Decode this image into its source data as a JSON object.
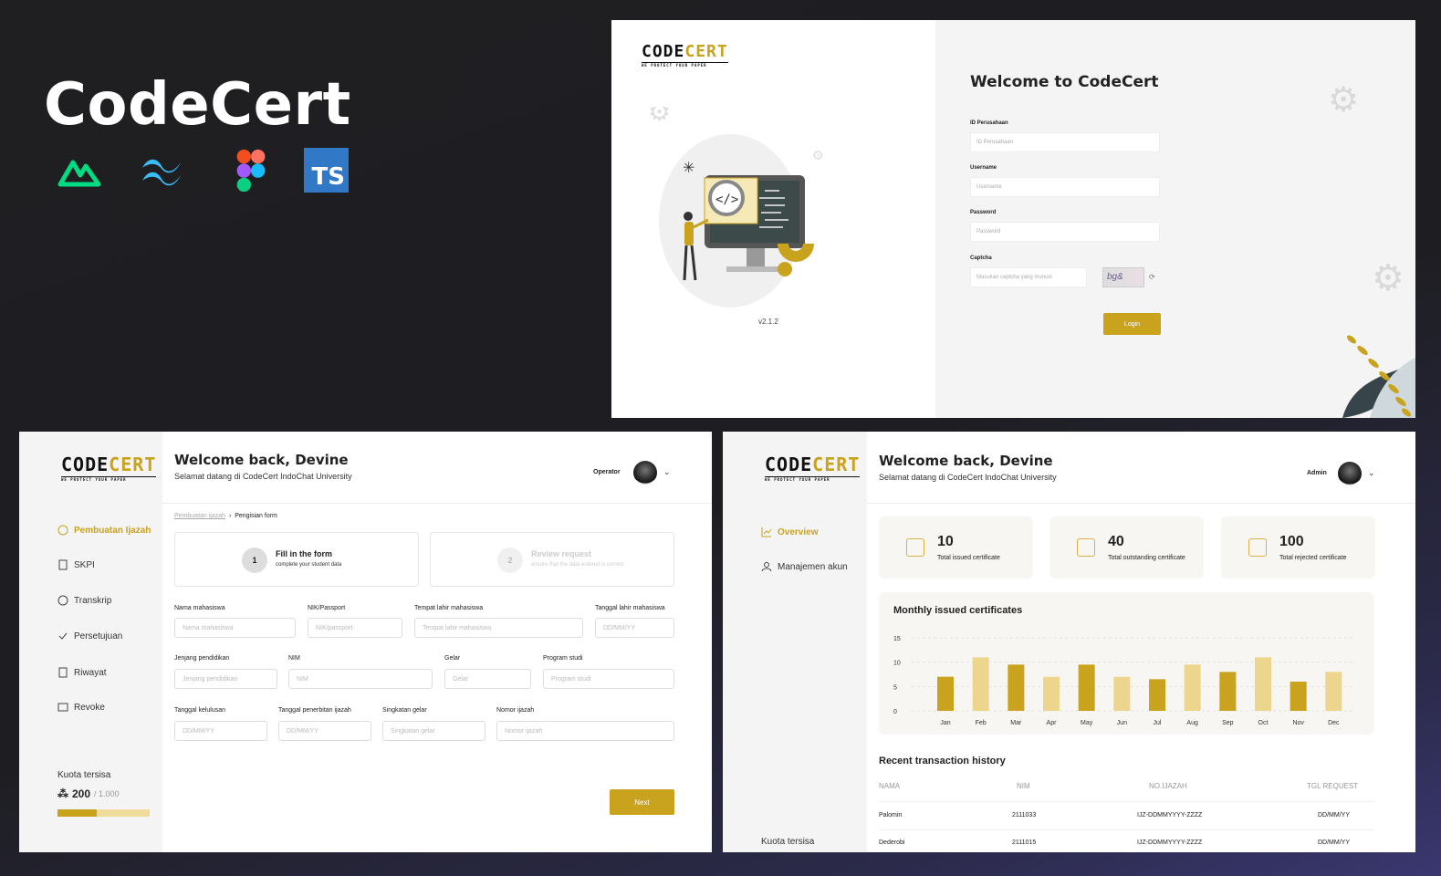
{
  "hero": {
    "title": "CodeCert",
    "tech_icons": [
      "nuxt-icon",
      "tailwind-icon",
      "figma-icon",
      "typescript-icon"
    ],
    "ts_label": "TS"
  },
  "brand": {
    "logo_code": "CODE",
    "logo_cert": "CERT",
    "logo_tagline": "WE PROTECT YOUR PAPER",
    "accent": "#c9a21e"
  },
  "login": {
    "version": "v2.1.2",
    "title": "Welcome to CodeCert",
    "fields": [
      {
        "label": "ID Perusahaan",
        "placeholder": "ID Perusahaan"
      },
      {
        "label": "Username",
        "placeholder": "Username"
      },
      {
        "label": "Password",
        "placeholder": "Password"
      }
    ],
    "captcha_label": "Captcha",
    "captcha_placeholder": "Masukan captcha yang muncul",
    "captcha_text": "bg&",
    "login_button": "Login"
  },
  "operator": {
    "welcome": "Welcome back, Devine",
    "subtitle": "Selamat datang di CodeCert IndoChat University",
    "role": "Operator",
    "nav": [
      "Pembuatan Ijazah",
      "SKPI",
      "Transkrip",
      "Persetujuan",
      "Riwayat",
      "Revoke"
    ],
    "quota_label": "Kuota tersisa",
    "quota_value": "200",
    "quota_total": "/ 1.000",
    "quota_fraction": 0.43,
    "breadcrumb": {
      "parent": "Pembuatan ijazah",
      "current": "Pengisian form"
    },
    "steps": [
      {
        "num": "1",
        "title": "Fill in the form",
        "subtitle": "complete your student data"
      },
      {
        "num": "2",
        "title": "Review request",
        "subtitle": "ensure that the data entered is correct"
      }
    ],
    "form": {
      "row1": [
        {
          "label": "Nama mahasiswa",
          "placeholder": "Nama mahasiswa"
        },
        {
          "label": "NIK/Passport",
          "placeholder": "NIK/passport"
        },
        {
          "label": "Tempat lahir mahasiswa",
          "placeholder": "Tempat lahir mahasiswa"
        },
        {
          "label": "Tanggal lahir mahasiswa",
          "placeholder": "DD/MM/YY"
        }
      ],
      "row2": [
        {
          "label": "Jenjang pendidikan",
          "placeholder": "Jenjang pendidikan"
        },
        {
          "label": "NIM",
          "placeholder": "NIM"
        },
        {
          "label": "Gelar",
          "placeholder": "Gelar"
        },
        {
          "label": "Program studi",
          "placeholder": "Program studi"
        }
      ],
      "row3": [
        {
          "label": "Tanggal kelulusan",
          "placeholder": "DD/MM/YY"
        },
        {
          "label": "Tanggal penerbitan ijazah",
          "placeholder": "DD/MM/YY"
        },
        {
          "label": "Singkatan gelar",
          "placeholder": "Singkatan gelar"
        },
        {
          "label": "Nomor ijazah",
          "placeholder": "Nomor ijazah"
        }
      ]
    },
    "next_button": "Next"
  },
  "admin": {
    "welcome": "Welcome back, Devine",
    "subtitle": "Selamat datang di CodeCert IndoChat University",
    "role": "Admin",
    "nav": [
      "Overview",
      "Manajemen akun"
    ],
    "quota_label": "Kuota tersisa",
    "stats": [
      {
        "value": "10",
        "label": "Total issued certificate"
      },
      {
        "value": "40",
        "label": "Total outstanding certificate"
      },
      {
        "value": "100",
        "label": "Total rejected certificate"
      }
    ],
    "recent_title": "Recent transaction history",
    "table_headers": [
      "NAMA",
      "NIM",
      "NO.IJAZAH",
      "TGL REQUEST"
    ],
    "table_rows": [
      [
        "Palomin",
        "2111033",
        "IJZ-DDMMYYYY-ZZZZ",
        "DD/MM/YY"
      ],
      [
        "Dederobi",
        "2111015",
        "IJZ-DDMMYYYY-ZZZZ",
        "DD/MM/YY"
      ]
    ]
  },
  "chart_data": {
    "type": "bar",
    "title": "Monthly issued certificates",
    "categories": [
      "Jan",
      "Feb",
      "Mar",
      "Apr",
      "May",
      "Jun",
      "Jul",
      "Aug",
      "Sep",
      "Oct",
      "Nov",
      "Dec"
    ],
    "values": [
      7,
      11,
      9.5,
      7,
      9.5,
      7,
      6.5,
      9.5,
      8,
      11,
      6,
      8
    ],
    "yticks": [
      0,
      5,
      10,
      15
    ],
    "ylim": [
      0,
      15
    ],
    "colors": [
      "#c9a21e",
      "#ecd68d"
    ],
    "xlabel": "",
    "ylabel": ""
  }
}
